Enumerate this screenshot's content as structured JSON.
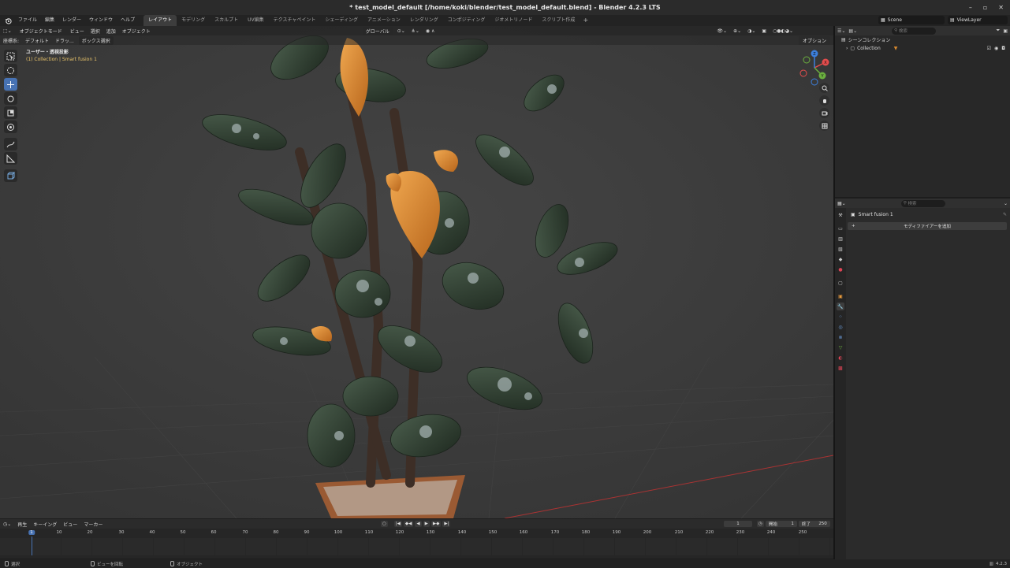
{
  "window": {
    "title": "* test_model_default [/home/koki/blender/test_model_default.blend] - Blender 4.2.3 LTS",
    "controls": [
      "–",
      "▫",
      "✕"
    ]
  },
  "menubar": {
    "menus": [
      "ファイル",
      "編集",
      "レンダー",
      "ウィンドウ",
      "ヘルプ"
    ],
    "workspaces": [
      "レイアウト",
      "モデリング",
      "スカルプト",
      "UV編集",
      "テクスチャペイント",
      "シェーディング",
      "アニメーション",
      "レンダリング",
      "コンポジティング",
      "ジオメトリノード",
      "スクリプト作成"
    ],
    "active_workspace": "レイアウト",
    "add_tab": "+",
    "scene": "Scene",
    "view_layer": "ViewLayer"
  },
  "viewport": {
    "header": {
      "mode": "オブジェクトモード",
      "menus": [
        "ビュー",
        "選択",
        "追加",
        "オブジェクト"
      ],
      "transform_orientation": "グローバル"
    },
    "header2": {
      "coord_label": "座標系:",
      "pivot": "デフォルト",
      "drag_label": "ドラッ...",
      "select_mode": "ボックス選択",
      "options": "オプション"
    },
    "info_line1": "ユーザー・透視投影",
    "info_line2": "(1) Collection | Smart fusion 1",
    "gizmo_labels": {
      "x": "X",
      "y": "Y",
      "z": "Z"
    }
  },
  "outliner": {
    "search_placeholder": "検索",
    "root": "シーンコレクション",
    "collection": "Collection"
  },
  "properties": {
    "search_placeholder": "検索",
    "object_name": "Smart fusion 1",
    "add_modifier": "モディファイアーを追加"
  },
  "timeline": {
    "menus": [
      "再生",
      "キーイング",
      "ビュー",
      "マーカー"
    ],
    "current_frame": "1",
    "start_label": "開始",
    "start": "1",
    "end_label": "終了",
    "end": "250",
    "ticks": [
      "10",
      "20",
      "30",
      "40",
      "50",
      "60",
      "70",
      "80",
      "90",
      "100",
      "110",
      "120",
      "130",
      "140",
      "150",
      "160",
      "170",
      "180",
      "190",
      "200",
      "210",
      "220",
      "230",
      "240",
      "250"
    ],
    "cursor_label": "1"
  },
  "statusbar": {
    "select": "選択",
    "rotate_view": "ビューを回転",
    "object": "オブジェクト",
    "version": "4.2.3"
  },
  "colors": {
    "accent": "#4772b3",
    "info_yellow": "#e9c46a",
    "axis_x": "#e34c4c",
    "axis_y": "#6bb03f",
    "axis_z": "#3c7fdc",
    "fruit_orange": "#d98a2f",
    "leaf_green": "#2f3f31"
  }
}
